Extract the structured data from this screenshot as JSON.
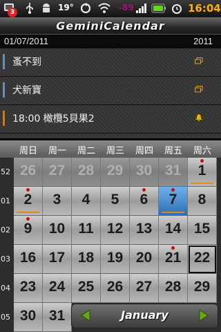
{
  "status_bar": {
    "notification_count": "3",
    "temperature": "19°",
    "signal_dbm": "-89",
    "time": "16:04",
    "icons": [
      "notification-badge-icon",
      "usb-icon",
      "android-icon",
      "sync-icon",
      "wifi-icon",
      "signal-icon",
      "battery-icon",
      "alarm-icon"
    ]
  },
  "app": {
    "title": "GeminiCalendar"
  },
  "header": {
    "date": "01/07/2011",
    "year": "2011"
  },
  "events": [
    {
      "text": "蚤不到",
      "bar_color": "#6a8fb5",
      "icon": "multi-day-icon"
    },
    {
      "text": "犬新寶",
      "bar_color": "#6a8fb5",
      "icon": "multi-day-icon"
    },
    {
      "text": "18:00 橄欖5貝果2",
      "bar_color": "#d47a14",
      "icon": "bell-icon"
    }
  ],
  "weekdays": [
    "周日",
    "周一",
    "周二",
    "周三",
    "周四",
    "周五",
    "周六"
  ],
  "weeks": [
    {
      "week_no": "52",
      "days": [
        {
          "d": "26",
          "dim": true
        },
        {
          "d": "27",
          "dim": true
        },
        {
          "d": "28",
          "dim": true
        },
        {
          "d": "29",
          "dim": true
        },
        {
          "d": "30",
          "dim": true
        },
        {
          "d": "31",
          "dim": true
        },
        {
          "d": "1",
          "dot": true,
          "arrow": true
        }
      ]
    },
    {
      "week_no": "01",
      "days": [
        {
          "d": "2",
          "dot": true,
          "arrow": true
        },
        {
          "d": "3"
        },
        {
          "d": "4"
        },
        {
          "d": "5"
        },
        {
          "d": "6",
          "dot": true
        },
        {
          "d": "7",
          "selected": true,
          "dot": true,
          "arrow": true
        },
        {
          "d": "8"
        }
      ]
    },
    {
      "week_no": "02",
      "days": [
        {
          "d": "9",
          "dot": true
        },
        {
          "d": "10"
        },
        {
          "d": "11"
        },
        {
          "d": "12"
        },
        {
          "d": "13"
        },
        {
          "d": "14"
        },
        {
          "d": "15"
        }
      ]
    },
    {
      "week_no": "03",
      "days": [
        {
          "d": "16"
        },
        {
          "d": "17"
        },
        {
          "d": "18"
        },
        {
          "d": "19"
        },
        {
          "d": "20"
        },
        {
          "d": "21",
          "dot": true
        },
        {
          "d": "22",
          "today": true
        }
      ]
    },
    {
      "week_no": "04",
      "days": [
        {
          "d": "23"
        },
        {
          "d": "24"
        },
        {
          "d": "25"
        },
        {
          "d": "26"
        },
        {
          "d": "27"
        },
        {
          "d": "28"
        },
        {
          "d": "29"
        }
      ]
    },
    {
      "week_no": "05",
      "days": [
        {
          "d": "30"
        },
        {
          "d": "31"
        }
      ]
    }
  ],
  "month_selector": {
    "month": "January"
  },
  "colors": {
    "accent": "#ffb000",
    "selected": "#2f7cc4",
    "event_dot": "#c51010",
    "multi_day_arrow": "#e38b11"
  }
}
